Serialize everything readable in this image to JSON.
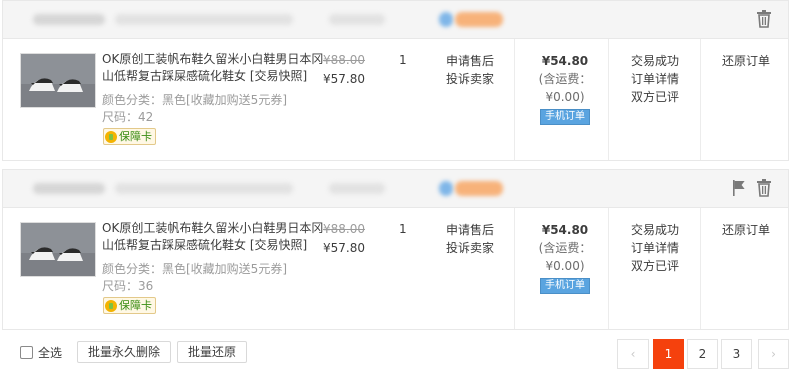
{
  "orders": [
    {
      "product": {
        "title": "OK原创工装帆布鞋久留米小白鞋男日本冈山低帮复古踩屎感硫化鞋女 [交易快照]",
        "attr": "颜色分类：黑色[收藏加购送5元券] 尺码：42",
        "badge": "保障卡"
      },
      "price_original": "¥88.00",
      "price_now": "¥57.80",
      "quantity": "1",
      "after_sales": [
        "申请售后",
        "投诉卖家"
      ],
      "total": "¥54.80",
      "shipping": "(含运费：¥0.00)",
      "mobile_tag": "手机订单",
      "status": [
        "交易成功",
        "订单详情",
        "双方已评"
      ],
      "restore": "还原订单",
      "icons": [
        "trash-icon"
      ]
    },
    {
      "product": {
        "title": "OK原创工装帆布鞋久留米小白鞋男日本冈山低帮复古踩屎感硫化鞋女 [交易快照]",
        "attr": "颜色分类：黑色[收藏加购送5元券] 尺码：36",
        "badge": "保障卡"
      },
      "price_original": "¥88.00",
      "price_now": "¥57.80",
      "quantity": "1",
      "after_sales": [
        "申请售后",
        "投诉卖家"
      ],
      "total": "¥54.80",
      "shipping": "(含运费：¥0.00)",
      "mobile_tag": "手机订单",
      "status": [
        "交易成功",
        "订单详情",
        "双方已评"
      ],
      "restore": "还原订单",
      "icons": [
        "flag-icon",
        "trash-icon"
      ]
    }
  ],
  "footer": {
    "select_all": "全选",
    "batch_delete": "批量永久删除",
    "batch_restore": "批量还原"
  },
  "pagination": {
    "prev": "‹",
    "pages": [
      "1",
      "2",
      "3"
    ],
    "current": "1",
    "next": "›"
  },
  "colors": {
    "accent": "#f5410d",
    "mobile_tag": "#5aa4e0",
    "guarantee": "#3a8d13"
  }
}
